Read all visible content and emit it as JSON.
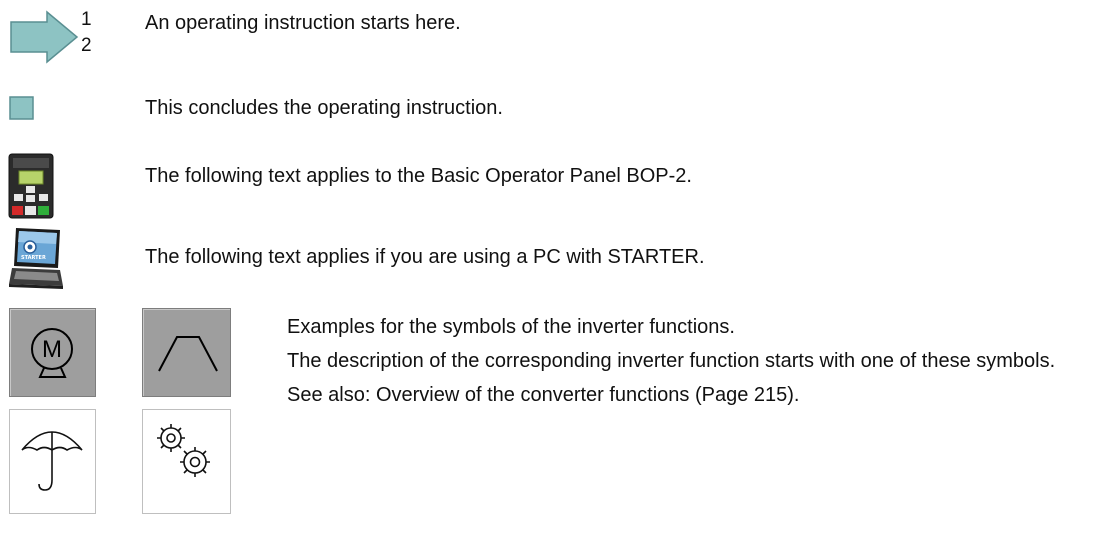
{
  "rows": [
    {
      "icon": "operating-instruction-start-arrow-icon",
      "text": "An operating instruction starts here.",
      "arrow_numbers": [
        "1",
        "2"
      ]
    },
    {
      "icon": "operating-instruction-end-square-icon",
      "text": "This concludes the operating instruction."
    },
    {
      "icon": "bop-2-operator-panel-icon",
      "text": "The following text applies to the Basic Operator Panel BOP-2."
    },
    {
      "icon": "laptop-starter-icon",
      "text": "The following text applies if you are using a PC with STARTER.",
      "screen_label": "STARTER"
    }
  ],
  "function_symbols": {
    "icons": [
      "motor-icon",
      "ramp-icon",
      "umbrella-icon",
      "gears-icon"
    ],
    "motor_letter": "M",
    "paragraph_1": "Examples for the symbols of the inverter functions.",
    "paragraph_2": "The description of the corresponding inverter function starts with one of these symbols.",
    "paragraph_3": "See also: Overview of the converter functions (Page 215)."
  },
  "colors": {
    "arrow_fill": "#8dc3c3",
    "tile_gray": "#9e9e9e",
    "text": "#111111"
  }
}
